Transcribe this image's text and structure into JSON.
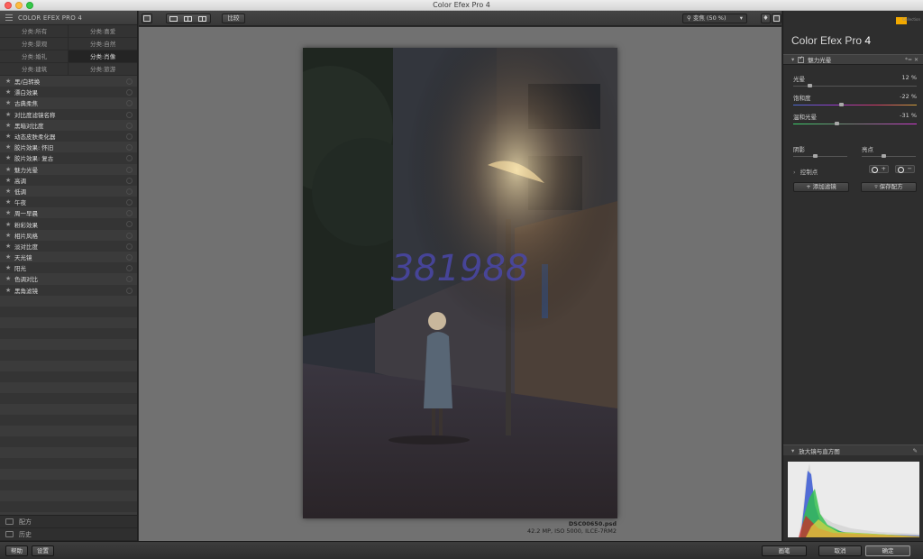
{
  "window": {
    "title": "Color Efex Pro 4"
  },
  "left_panel": {
    "header": "COLOR EFEX PRO 4",
    "categories": [
      {
        "label": "分类:所有",
        "active": false
      },
      {
        "label": "分类:喜爱",
        "active": false
      },
      {
        "label": "分类:景观",
        "active": false
      },
      {
        "label": "分类:自然",
        "active": false
      },
      {
        "label": "分类:婚礼",
        "active": false
      },
      {
        "label": "分类:肖像",
        "active": true
      },
      {
        "label": "分类:建筑",
        "active": false
      },
      {
        "label": "分类:旅游",
        "active": false
      }
    ],
    "filters": [
      "黑/白转换",
      "漂白效果",
      "古典柔焦",
      "对比度滤镜名称",
      "黑暗对比度",
      "动态皮肤柔化器",
      "胶片效果: 怀旧",
      "胶片效果: 复古",
      "魅力光晕",
      "高调",
      "低调",
      "午夜",
      "周一早晨",
      "粉彩效果",
      "相片风格",
      "淡对比度",
      "天光镜",
      "阳光",
      "色调对比",
      "黑角滤镜"
    ],
    "bottom": {
      "recipes": "配方",
      "history": "历史"
    }
  },
  "toolbar": {
    "compare": "比较",
    "zoom": "变焦 (50 %)"
  },
  "image": {
    "filename": "DSC00650.psd",
    "info": "42.2 MP, ISO 5000, ILCE-7RM2",
    "watermark": "381988"
  },
  "right_panel": {
    "brand_small": "Collection",
    "title_main": "Color Efex Pro",
    "title_num": "4",
    "filter_name": "魅力光晕",
    "sliders": [
      {
        "label": "光晕",
        "value": "12 %",
        "level": 0.12
      },
      {
        "label": "饱和度",
        "value": "-22 %",
        "level": 0.39
      },
      {
        "label": "温和光晕",
        "value": "-31 %",
        "level": 0.35
      }
    ],
    "shadows_label": "阴影",
    "highlights_label": "亮点",
    "control_points": "控制点",
    "add_filter": "添加滤镜",
    "save_recipe": "保存配方",
    "loupe": "放大镜与直方图"
  },
  "bottom_bar": {
    "help": "帮助",
    "settings": "设置",
    "brush": "画笔",
    "cancel": "取消",
    "ok": "确定"
  }
}
